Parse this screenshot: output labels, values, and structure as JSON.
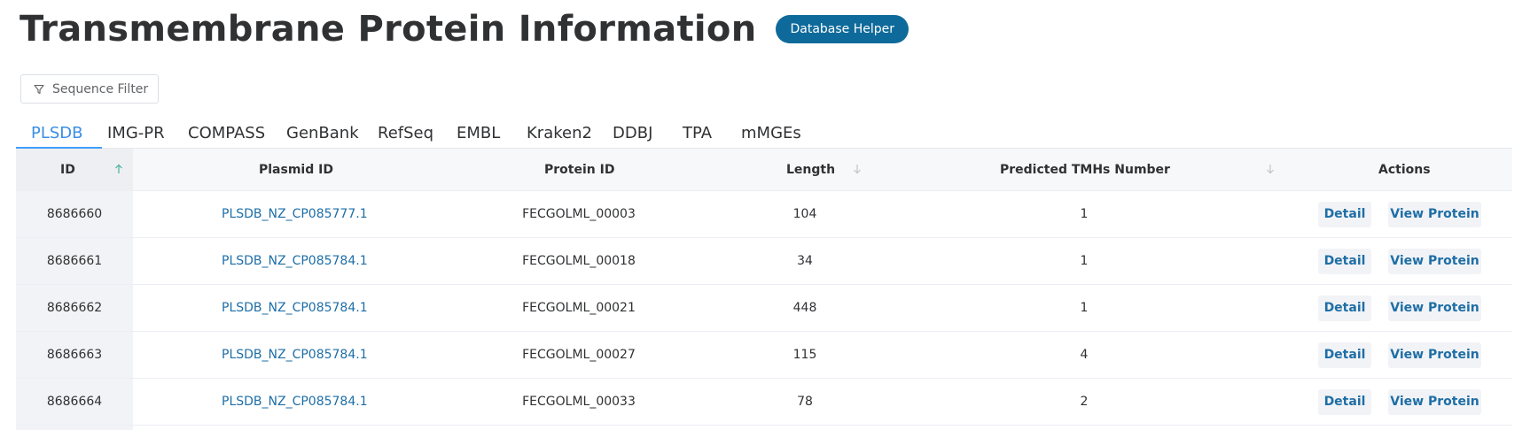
{
  "header": {
    "title": "Transmembrane Protein Information",
    "helper_label": "Database Helper"
  },
  "filter": {
    "label": "Sequence Filter",
    "icon": "filter-icon"
  },
  "tabs": [
    {
      "label": "PLSDB",
      "active": true
    },
    {
      "label": "IMG-PR"
    },
    {
      "label": "COMPASS"
    },
    {
      "label": "GenBank"
    },
    {
      "label": "RefSeq"
    },
    {
      "label": "EMBL"
    },
    {
      "label": "Kraken2"
    },
    {
      "label": "DDBJ"
    },
    {
      "label": "TPA"
    },
    {
      "label": "mMGEs"
    }
  ],
  "table": {
    "columns": {
      "id": "ID",
      "plasmid": "Plasmid ID",
      "protein": "Protein ID",
      "length": "Length",
      "tmh": "Predicted TMHs Number",
      "actions": "Actions"
    },
    "sort": {
      "id": "ascending",
      "length": "sortable",
      "tmh": "sortable"
    },
    "rows": [
      {
        "id": "8686660",
        "plasmid": "PLSDB_NZ_CP085777.1",
        "protein": "FECGOLML_00003",
        "length": "104",
        "tmh": "1"
      },
      {
        "id": "8686661",
        "plasmid": "PLSDB_NZ_CP085784.1",
        "protein": "FECGOLML_00018",
        "length": "34",
        "tmh": "1"
      },
      {
        "id": "8686662",
        "plasmid": "PLSDB_NZ_CP085784.1",
        "protein": "FECGOLML_00021",
        "length": "448",
        "tmh": "1"
      },
      {
        "id": "8686663",
        "plasmid": "PLSDB_NZ_CP085784.1",
        "protein": "FECGOLML_00027",
        "length": "115",
        "tmh": "4"
      },
      {
        "id": "8686664",
        "plasmid": "PLSDB_NZ_CP085784.1",
        "protein": "FECGOLML_00033",
        "length": "78",
        "tmh": "2"
      }
    ],
    "actions": {
      "detail_label": "Detail",
      "view_label": "View Protein"
    }
  },
  "colors": {
    "accent": "#0e6a9a",
    "link": "#1e6ea6",
    "active_tab": "#3a8ee6",
    "sort_active": "#4ab3a0"
  }
}
